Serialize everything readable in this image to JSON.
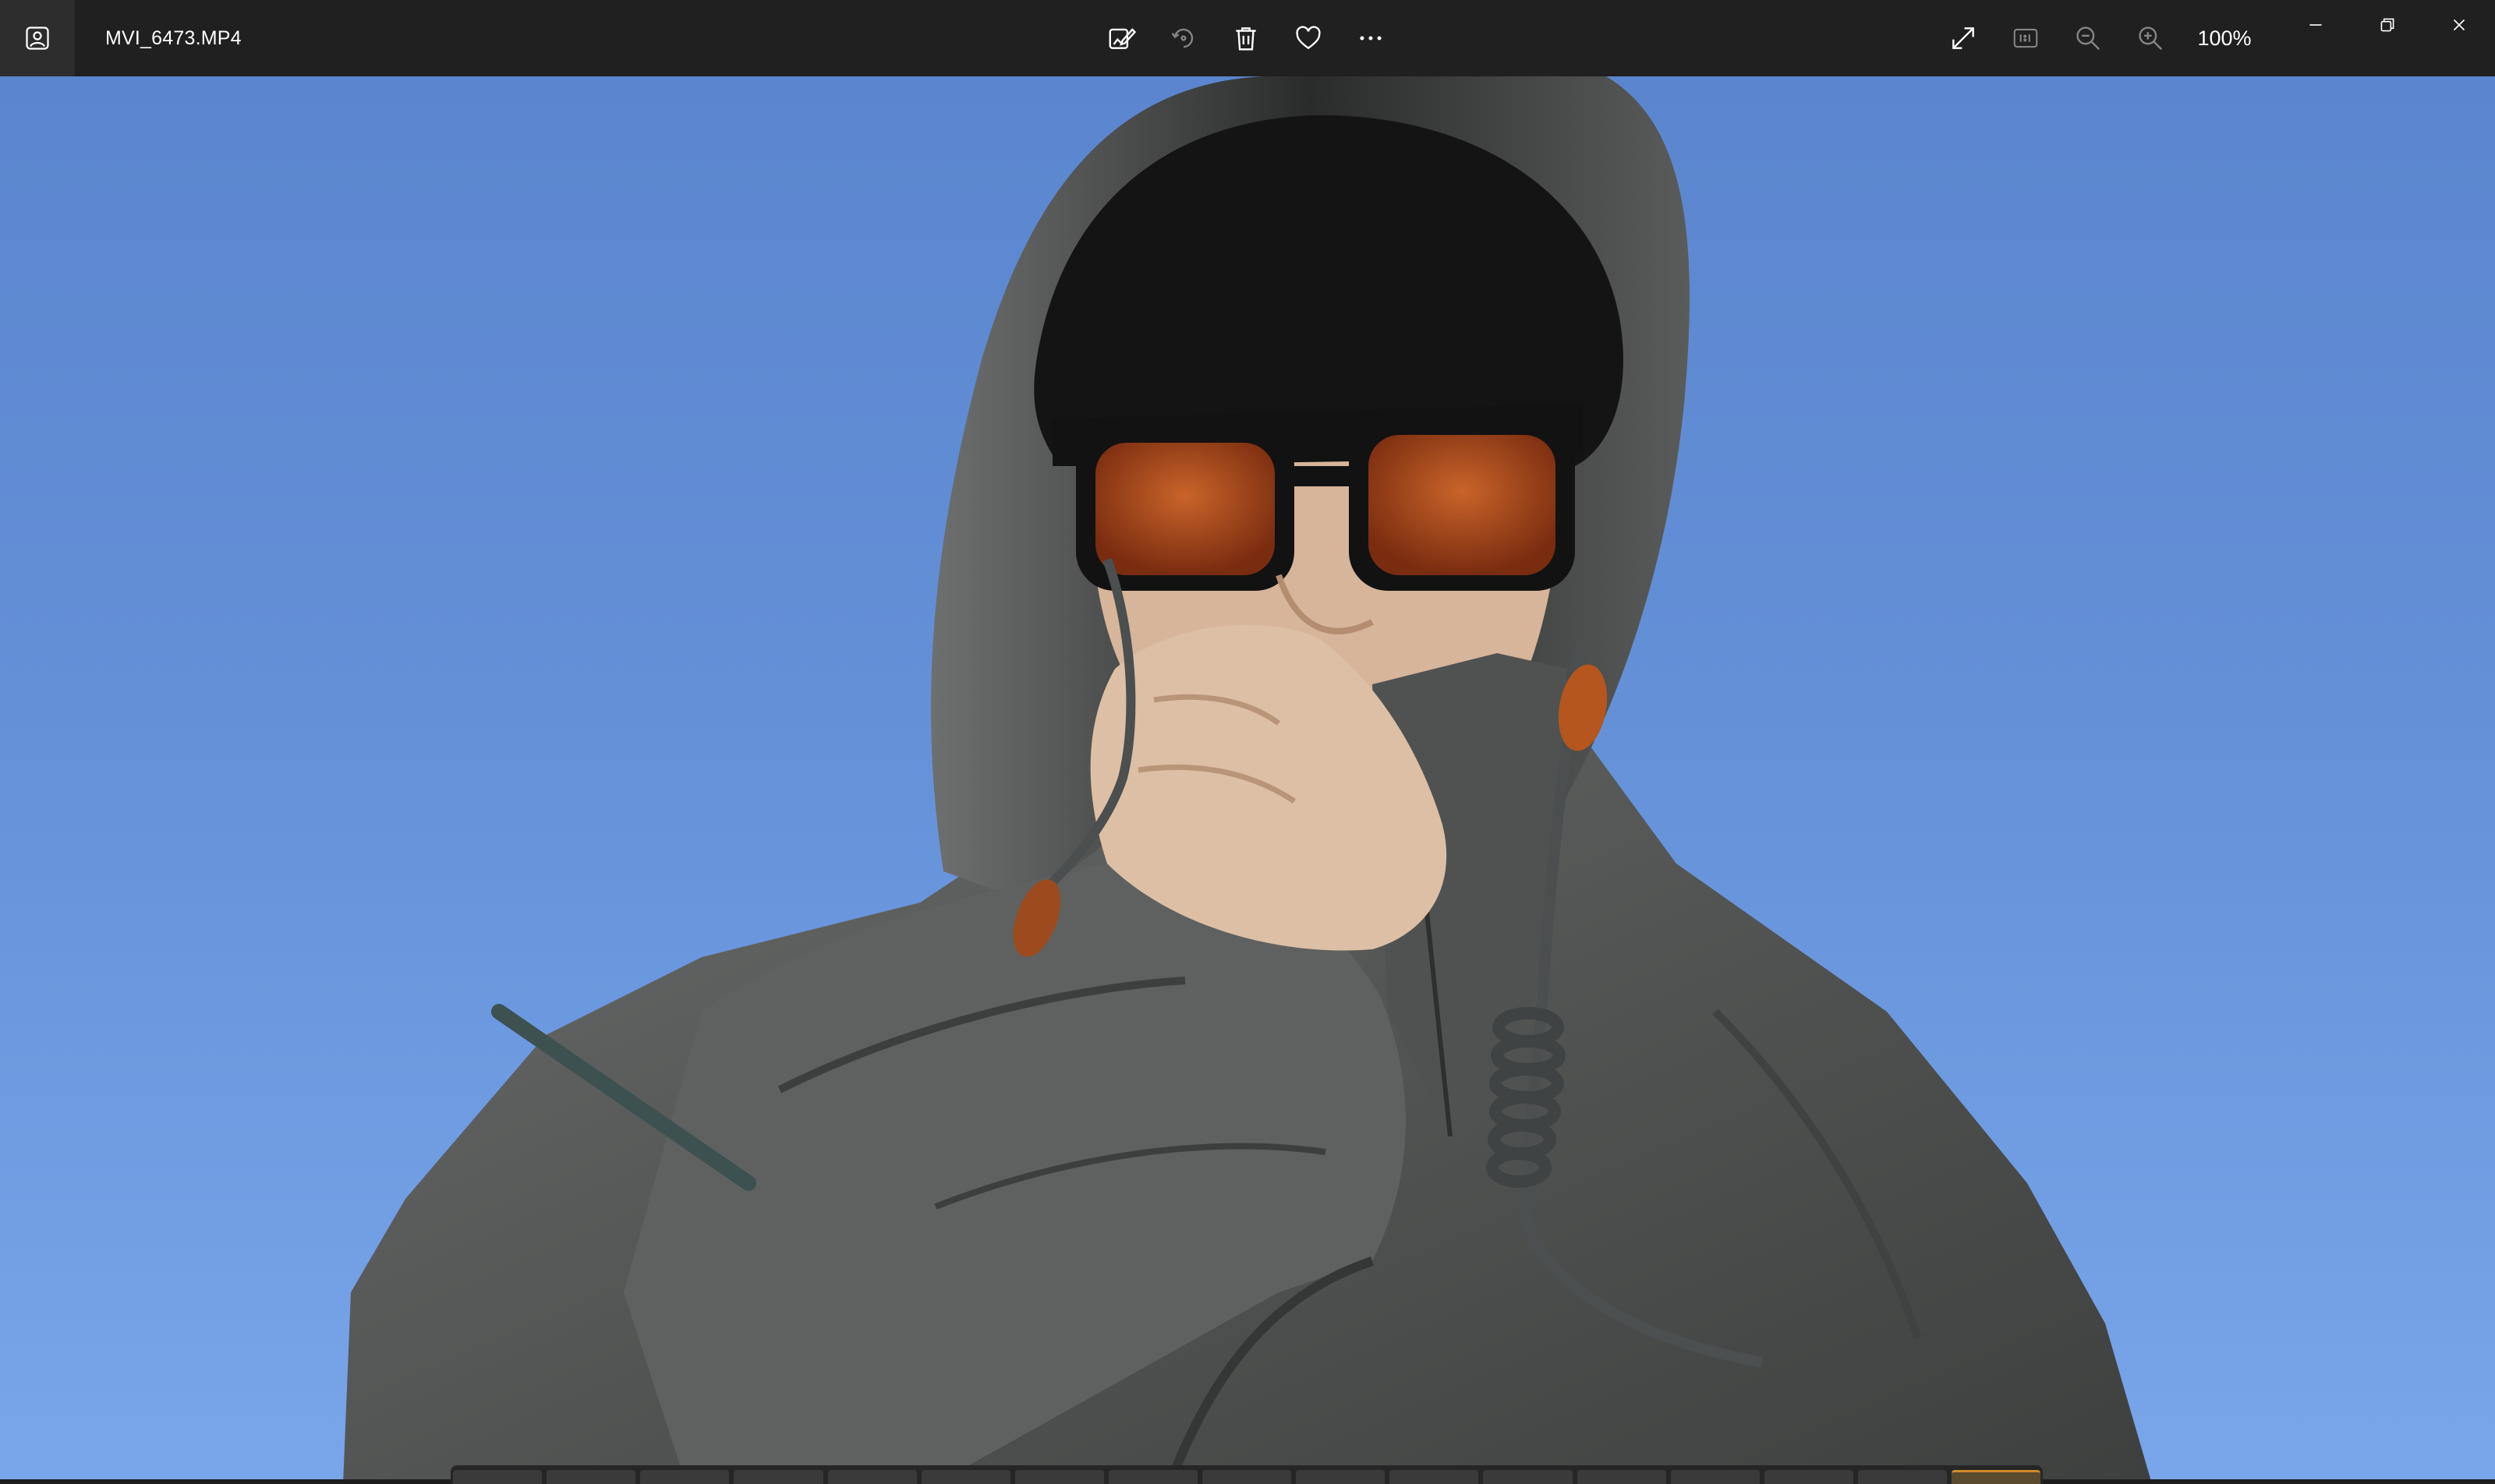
{
  "window": {
    "file_name": "MVI_6473.MP4"
  },
  "toolbar": {
    "center_icons": [
      "edit-image-icon",
      "rotate-icon",
      "delete-icon",
      "favorite-heart-icon",
      "more-options-icon"
    ],
    "right_icons": [
      "fullscreen-icon",
      "actual-size-icon",
      "zoom-out-icon",
      "zoom-in-icon"
    ],
    "zoom_level": "100%"
  },
  "window_controls": [
    "minimize-icon",
    "restore-icon",
    "close-icon"
  ],
  "colors": {
    "titlebar_bg": "#202020",
    "app_icon_bg": "#2d2d2d",
    "text": "#ffffff",
    "sky": "#6490d8",
    "jacket": "#5a5c5c",
    "lens": "#b24a1e",
    "accent": "#d08a2a"
  },
  "photo": {
    "subject": "person-in-hooded-jacket"
  }
}
